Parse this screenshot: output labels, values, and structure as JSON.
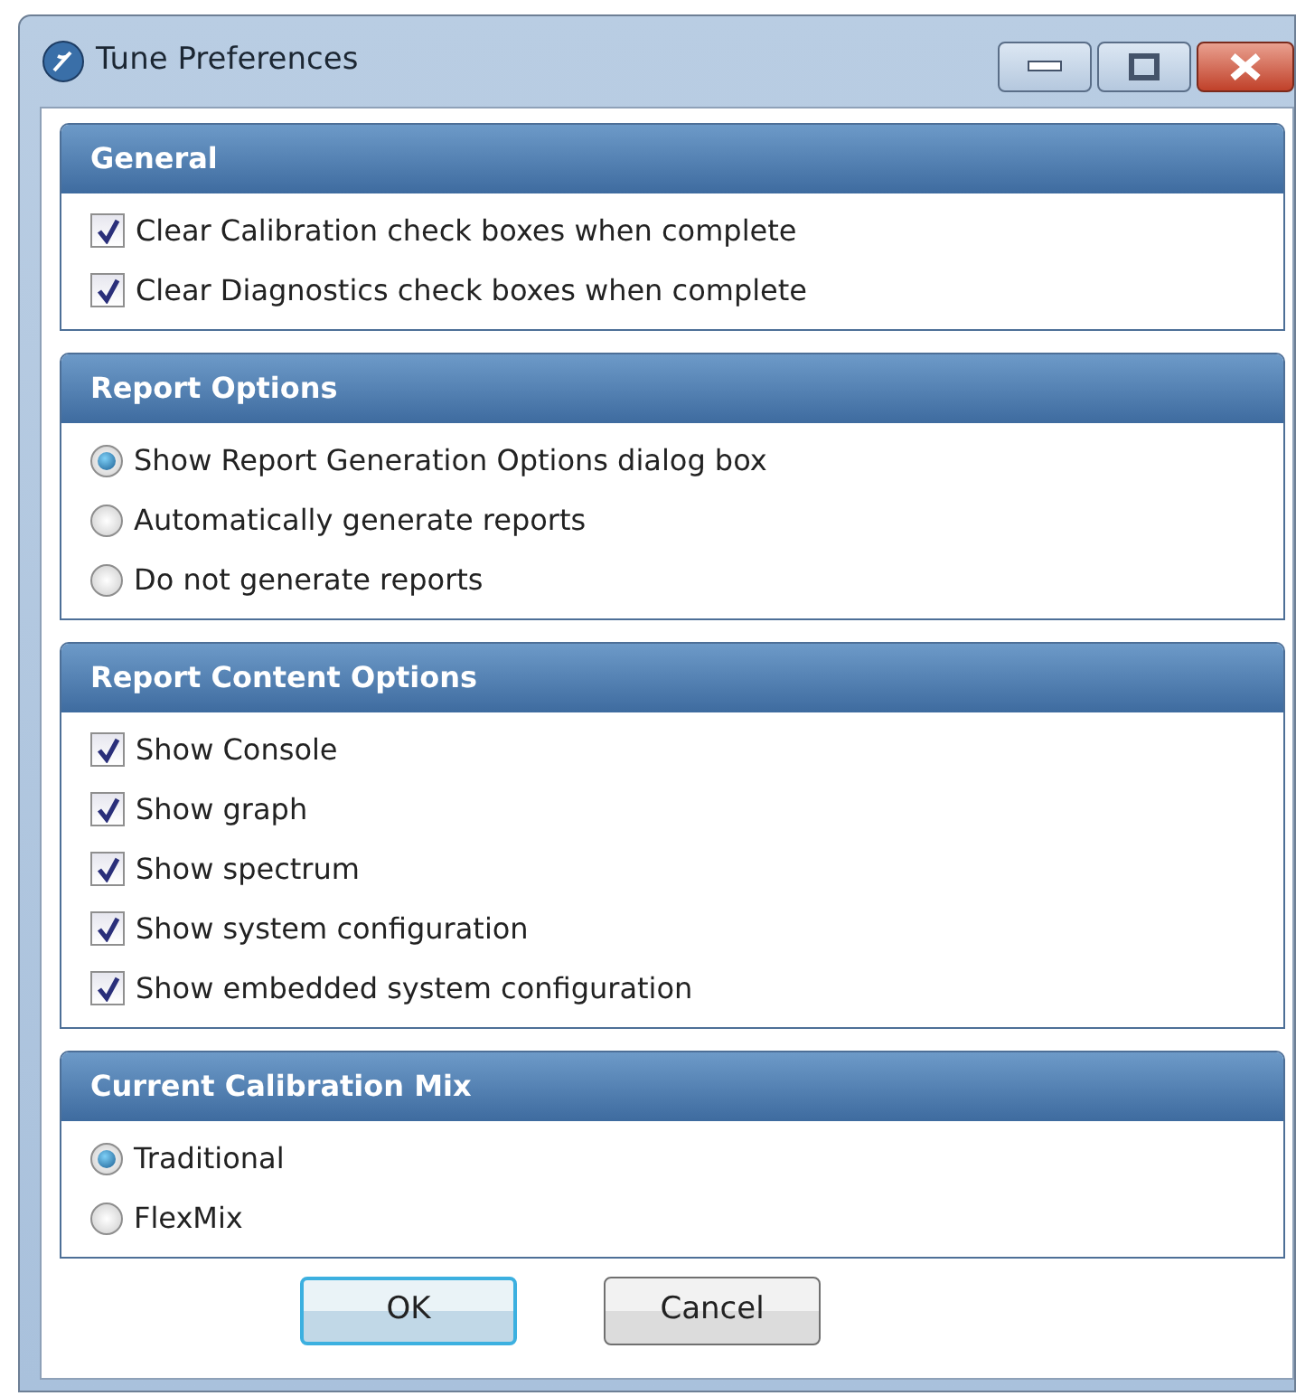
{
  "window": {
    "title": "Tune Preferences"
  },
  "sections": [
    {
      "title": "General",
      "items": [
        {
          "kind": "checkbox",
          "label": "Clear Calibration check boxes when complete",
          "checked": true
        },
        {
          "kind": "checkbox",
          "label": "Clear Diagnostics check boxes when complete",
          "checked": true
        }
      ]
    },
    {
      "title": "Report Options",
      "items": [
        {
          "kind": "radio",
          "label": "Show Report Generation Options dialog box",
          "selected": true
        },
        {
          "kind": "radio",
          "label": "Automatically generate reports",
          "selected": false
        },
        {
          "kind": "radio",
          "label": "Do not generate reports",
          "selected": false
        }
      ]
    },
    {
      "title": "Report Content Options",
      "items": [
        {
          "kind": "checkbox",
          "label": "Show Console",
          "checked": true
        },
        {
          "kind": "checkbox",
          "label": "Show graph",
          "checked": true
        },
        {
          "kind": "checkbox",
          "label": "Show spectrum",
          "checked": true
        },
        {
          "kind": "checkbox",
          "label": "Show system configuration",
          "checked": true
        },
        {
          "kind": "checkbox",
          "label": "Show embedded system configuration",
          "checked": true
        }
      ]
    },
    {
      "title": "Current Calibration Mix",
      "items": [
        {
          "kind": "radio",
          "label": "Traditional",
          "selected": true
        },
        {
          "kind": "radio",
          "label": "FlexMix",
          "selected": false
        }
      ]
    }
  ],
  "buttons": [
    {
      "label": "OK",
      "focused": true
    },
    {
      "label": "Cancel",
      "focused": false
    }
  ]
}
